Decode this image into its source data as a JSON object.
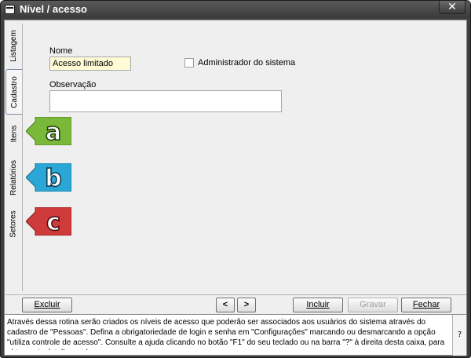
{
  "window": {
    "title": "Nível / acesso",
    "close_label": "✕"
  },
  "tabs": [
    {
      "label": "Listagem",
      "active": false
    },
    {
      "label": "Cadastro",
      "active": true
    },
    {
      "label": "Itens",
      "active": false
    },
    {
      "label": "Relatórios",
      "active": false
    },
    {
      "label": "Setores",
      "active": false
    }
  ],
  "form": {
    "nome_label": "Nome",
    "nome_value": "Acesso limitado",
    "admin_label": "Administrador do sistema",
    "admin_checked": false,
    "obs_label": "Observação",
    "obs_value": ""
  },
  "markers": [
    {
      "letter": "a",
      "color": "#7ab83a"
    },
    {
      "letter": "b",
      "color": "#2aa7d6"
    },
    {
      "letter": "c",
      "color": "#cf3a3a"
    }
  ],
  "toolbar": {
    "excluir": "Excluir",
    "prev": "<",
    "next": ">",
    "incluir": "Incluir",
    "gravar": "Gravar",
    "fechar": "Fechar"
  },
  "help": {
    "text": "Através dessa rotina serão criados os níveis de acesso que poderão ser associados aos usuários do sistema através do cadastro de \"Pessoas\". Defina a obrigatoriedade de login e senha em \"Configurações\" marcando ou desmarcando a opção \"utiliza controle de acesso\". Consulte a ajuda clicando no botão \"F1\" do seu teclado ou na barra \"?\" à direita desta caixa, para obter mais detalhes sobre",
    "question": "?"
  }
}
